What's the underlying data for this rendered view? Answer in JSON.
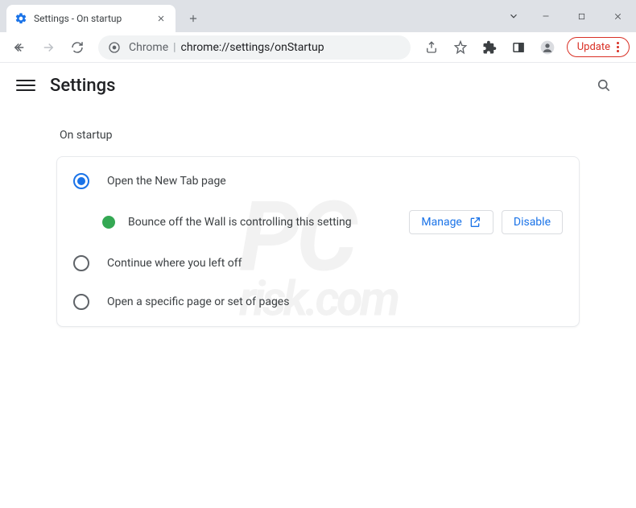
{
  "window": {
    "tab_title": "Settings - On startup"
  },
  "toolbar": {
    "omnibox_prefix": "Chrome",
    "omnibox_url": "chrome://settings/onStartup",
    "update_label": "Update"
  },
  "header": {
    "title": "Settings"
  },
  "section": {
    "title": "On startup",
    "options": [
      {
        "label": "Open the New Tab page",
        "checked": true
      },
      {
        "label": "Continue where you left off",
        "checked": false
      },
      {
        "label": "Open a specific page or set of pages",
        "checked": false
      }
    ],
    "extension": {
      "message": "Bounce off the Wall is controlling this setting",
      "manage_label": "Manage",
      "disable_label": "Disable"
    }
  },
  "watermark": {
    "line1": "PC",
    "line2": "risk.com"
  }
}
